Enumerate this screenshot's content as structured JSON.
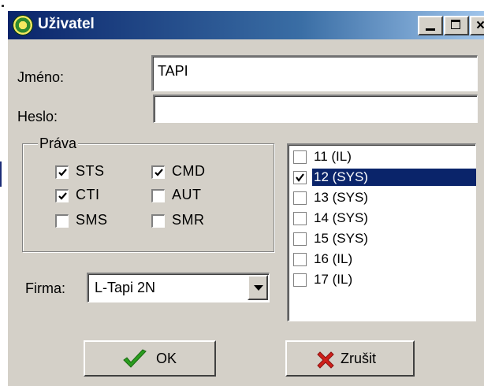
{
  "window": {
    "title": "Uživatel",
    "icon": "user-globe-icon"
  },
  "controls": {
    "minimize": "minimize-icon",
    "maximize": "maximize-icon",
    "close_glyph": "×"
  },
  "form": {
    "name_label": "Jméno:",
    "name_value": "TAPI",
    "password_label": "Heslo:",
    "password_value": "",
    "company_label": "Firma:",
    "company_value": "L-Tapi 2N"
  },
  "rights": {
    "legend": "Práva",
    "items": [
      {
        "label": "STS",
        "checked": true
      },
      {
        "label": "CMD",
        "checked": true
      },
      {
        "label": "CTI",
        "checked": true
      },
      {
        "label": "AUT",
        "checked": false
      },
      {
        "label": "SMS",
        "checked": false
      },
      {
        "label": "SMR",
        "checked": false
      }
    ]
  },
  "extensions": [
    {
      "label": "11 (IL)",
      "checked": false,
      "selected": false
    },
    {
      "label": "12 (SYS)",
      "checked": true,
      "selected": true
    },
    {
      "label": "13 (SYS)",
      "checked": false,
      "selected": false
    },
    {
      "label": "14 (SYS)",
      "checked": false,
      "selected": false
    },
    {
      "label": "15 (SYS)",
      "checked": false,
      "selected": false
    },
    {
      "label": "16 (IL)",
      "checked": false,
      "selected": false
    },
    {
      "label": "17 (IL)",
      "checked": false,
      "selected": false
    }
  ],
  "buttons": {
    "ok": "OK",
    "cancel": "Zrušit"
  },
  "colors": {
    "titlebar": "#0a246a",
    "selection": "#0a246a",
    "face": "#d4d0c8",
    "ok_check": "#2a9d1f",
    "cancel_x": "#d0201a"
  }
}
